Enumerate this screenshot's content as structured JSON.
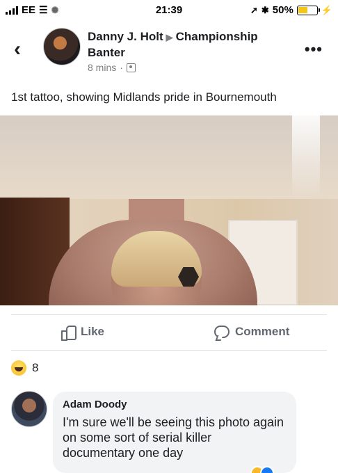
{
  "status": {
    "carrier": "EE",
    "time": "21:39",
    "battery": "50%",
    "battery_level": 0.5
  },
  "post": {
    "author": "Danny J. Holt",
    "group": "Championship Banter",
    "time": "8 mins",
    "caption": "1st tattoo, showing Midlands pride in Bournemouth"
  },
  "actions": {
    "like_label": "Like",
    "comment_label": "Comment"
  },
  "reactions": {
    "count": "8"
  },
  "comment": {
    "author": "Adam Doody",
    "text": "I'm sure we'll be seeing this photo again on some sort of serial killer documentary one day"
  },
  "colors": {
    "accent": "#1877f2",
    "secondary_text": "#7d7f83",
    "bubble": "#f2f3f5"
  }
}
